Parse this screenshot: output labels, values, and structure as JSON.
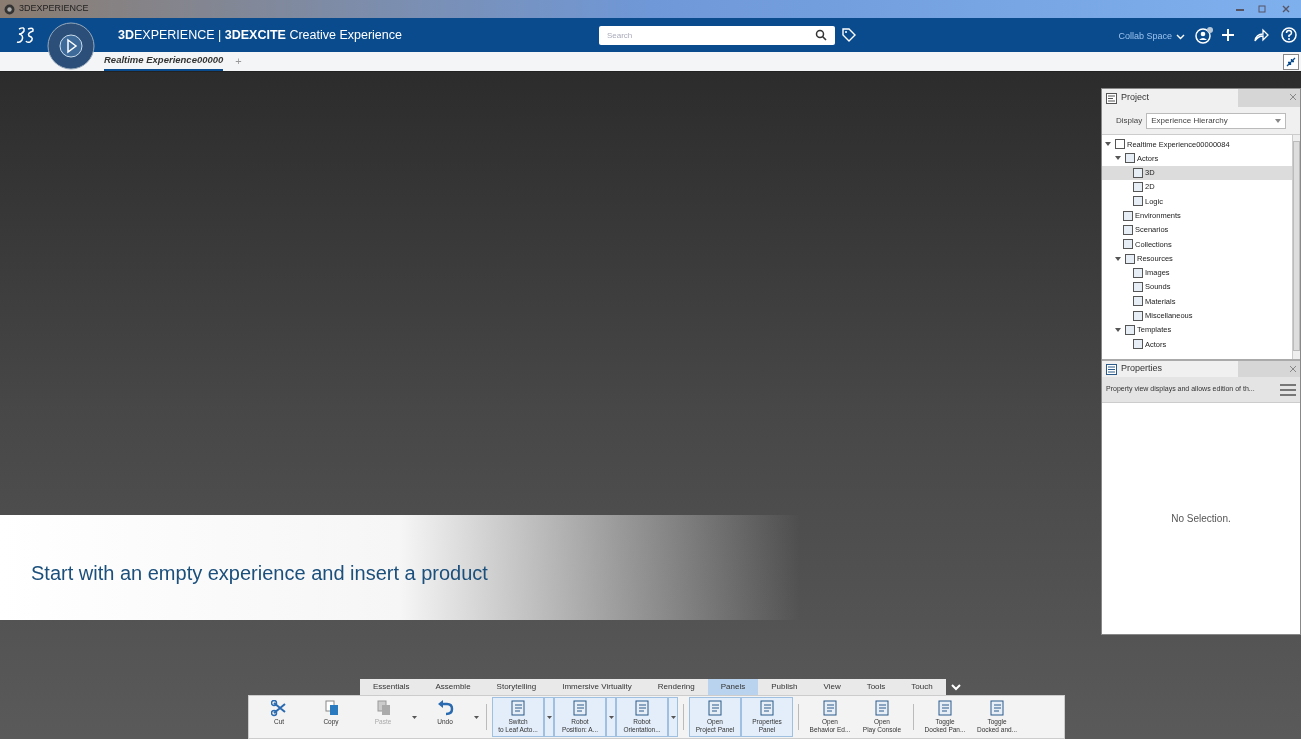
{
  "window": {
    "title": "3DEXPERIENCE"
  },
  "app_bar": {
    "title": "**3D**EXPERIENCE | **3DEXCITE** Creative Experience",
    "search": {
      "placeholder": "Search"
    },
    "collab_space": "Collab Space"
  },
  "tabs": [
    {
      "label": "Realtime Experience00000",
      "selected": true
    },
    {
      "label": "+",
      "selected": false
    }
  ],
  "banner": {
    "text": "Start with an empty experience and insert a product"
  },
  "project_panel": {
    "title": "Project",
    "display_label": "Display",
    "display_value": "Experience Hierarchy",
    "tree": [
      {
        "label": "Realtime Experience00000084",
        "expanded": true,
        "selected": false,
        "children": [
          {
            "label": "Actors",
            "expanded": true,
            "selected": false,
            "children": [
              {
                "label": "3D",
                "selected": true
              },
              {
                "label": "2D",
                "selected": false
              },
              {
                "label": "Logic",
                "selected": false
              }
            ]
          },
          {
            "label": "Environments",
            "selected": false
          },
          {
            "label": "Scenarios",
            "selected": false
          },
          {
            "label": "Collections",
            "selected": false
          },
          {
            "label": "Resources",
            "expanded": true,
            "selected": false,
            "children": [
              {
                "label": "Images",
                "selected": false
              },
              {
                "label": "Sounds",
                "selected": false
              },
              {
                "label": "Materials",
                "selected": false
              },
              {
                "label": "Miscellaneous",
                "selected": false
              }
            ]
          },
          {
            "label": "Templates",
            "expanded": true,
            "selected": false,
            "children": [
              {
                "label": "Actors",
                "selected": false
              }
            ]
          }
        ]
      }
    ]
  },
  "properties_panel": {
    "title": "Properties",
    "description": "Property view displays and allows edition of th...",
    "empty_text": "No Selection."
  },
  "ribbon": {
    "tabs": [
      {
        "label": "Essentials",
        "selected": false
      },
      {
        "label": "Assemble",
        "selected": false
      },
      {
        "label": "Storytelling",
        "selected": false
      },
      {
        "label": "Immersive Virtuality",
        "selected": false
      },
      {
        "label": "Rendering",
        "selected": false
      },
      {
        "label": "Panels",
        "selected": true
      },
      {
        "label": "Publish",
        "selected": false
      },
      {
        "label": "View",
        "selected": false
      },
      {
        "label": "Tools",
        "selected": false
      },
      {
        "label": "Touch",
        "selected": false
      }
    ],
    "groups": [
      [
        {
          "label": [
            "Cut"
          ],
          "dropdown": false,
          "active": false,
          "disabled": false
        },
        {
          "label": [
            "Copy"
          ],
          "dropdown": false,
          "active": false,
          "disabled": false
        },
        {
          "label": [
            "Paste"
          ],
          "dropdown": true,
          "active": false,
          "disabled": true
        },
        {
          "label": [
            "Undo"
          ],
          "dropdown": true,
          "active": false,
          "disabled": false
        }
      ],
      [
        {
          "label": [
            "Switch",
            "to Leaf Acto..."
          ],
          "dropdown": true,
          "active": true,
          "disabled": false
        },
        {
          "label": [
            "Robot",
            "Position: A..."
          ],
          "dropdown": true,
          "active": true,
          "disabled": false
        },
        {
          "label": [
            "Robot",
            "Orientation..."
          ],
          "dropdown": true,
          "active": true,
          "disabled": false
        }
      ],
      [
        {
          "label": [
            "Open",
            "Project Panel"
          ],
          "dropdown": false,
          "active": true,
          "disabled": false
        },
        {
          "label": [
            "Properties",
            "Panel"
          ],
          "dropdown": false,
          "active": true,
          "disabled": false
        }
      ],
      [
        {
          "label": [
            "Open",
            "Behavior Ed..."
          ],
          "dropdown": false,
          "active": false,
          "disabled": false
        },
        {
          "label": [
            "Open",
            "Play Console"
          ],
          "dropdown": false,
          "active": false,
          "disabled": false
        }
      ],
      [
        {
          "label": [
            "Toggle",
            "Docked Pan..."
          ],
          "dropdown": false,
          "active": false,
          "disabled": false
        },
        {
          "label": [
            "Toggle",
            "Docked and..."
          ],
          "dropdown": false,
          "active": false,
          "disabled": false
        }
      ]
    ]
  }
}
